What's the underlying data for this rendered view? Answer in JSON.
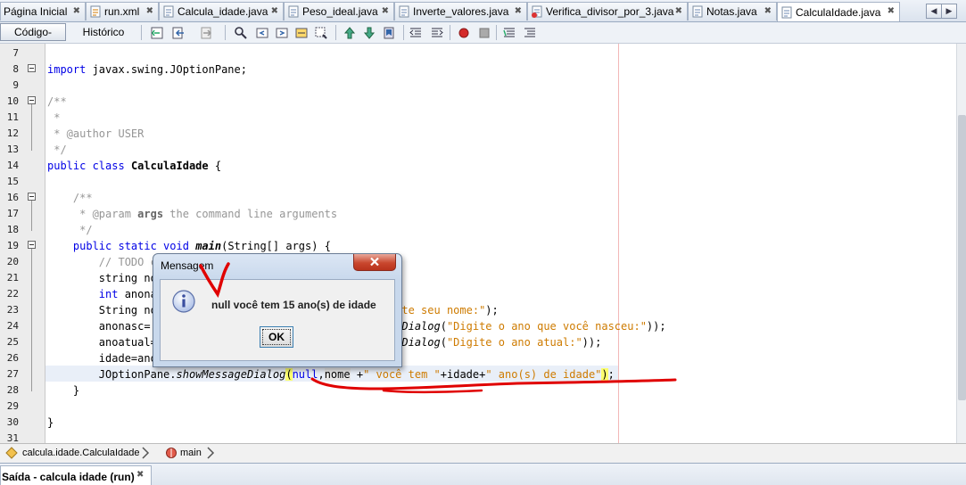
{
  "tabs": [
    {
      "label": "Página Inicial",
      "icon": "home-page-icon",
      "active": false
    },
    {
      "label": "run.xml",
      "icon": "xml-file-icon",
      "active": false
    },
    {
      "label": "Calcula_idade.java",
      "icon": "java-file-icon",
      "active": false
    },
    {
      "label": "Peso_ideal.java",
      "icon": "java-file-icon",
      "active": false
    },
    {
      "label": "Inverte_valores.java",
      "icon": "java-file-icon",
      "active": false
    },
    {
      "label": "Verifica_divisor_por_3.java",
      "icon": "java-file-icon",
      "active": false
    },
    {
      "label": "Notas.java",
      "icon": "java-file-icon",
      "active": false
    },
    {
      "label": "CalculaIdade.java",
      "icon": "java-file-icon",
      "active": true
    }
  ],
  "toolbar": {
    "source_label": "Código-Fonte",
    "history_label": "Histórico"
  },
  "editor": {
    "line_numbers": [
      "7",
      "8",
      "9",
      "10",
      "11",
      "12",
      "13",
      "14",
      "15",
      "16",
      "17",
      "18",
      "19",
      "20",
      "21",
      "22",
      "23",
      "24",
      "25",
      "26",
      "27",
      "28",
      "29",
      "30",
      "31"
    ],
    "highlighted_line": "27"
  },
  "breadcrumb": {
    "class_label": "calcula.idade.CalculaIdade",
    "method_label": "main"
  },
  "output": {
    "tab_label": "Saída - calcula idade (run)"
  },
  "dialog": {
    "title": "Mensagem",
    "message": "null você tem 15 ano(s) de idade",
    "ok_label": "OK",
    "icon": "information-icon"
  },
  "colors": {
    "keyword": "#0000e6",
    "string": "#ce7b00",
    "comment": "#969696",
    "annotation": "#e00000",
    "highlight_marker": "#fdff6e"
  }
}
